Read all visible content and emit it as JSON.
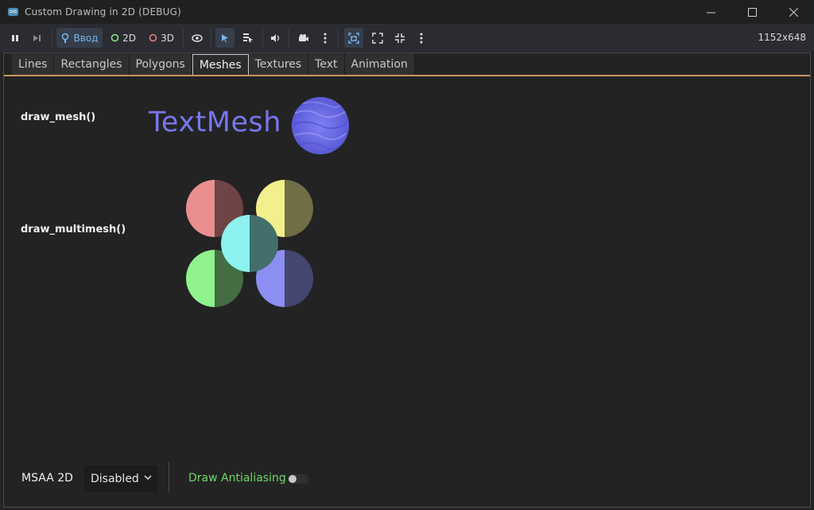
{
  "window": {
    "title": "Custom Drawing in 2D (DEBUG)",
    "resolution": "1152x648"
  },
  "toolbar": {
    "input_label": "Ввод",
    "mode_2d_label": "2D",
    "mode_3d_label": "3D"
  },
  "tabs": [
    {
      "label": "Lines",
      "active": false
    },
    {
      "label": "Rectangles",
      "active": false
    },
    {
      "label": "Polygons",
      "active": false
    },
    {
      "label": "Meshes",
      "active": true
    },
    {
      "label": "Textures",
      "active": false
    },
    {
      "label": "Text",
      "active": false
    },
    {
      "label": "Animation",
      "active": false
    }
  ],
  "meshes": {
    "draw_mesh_label": "draw_mesh()",
    "textmesh_text": "TextMesh",
    "draw_multimesh_label": "draw_multimesh()",
    "multimesh_colors": [
      "#e98f90",
      "#f2f08c",
      "#8ff28c",
      "#8c8ff2",
      "#8ef2ef"
    ]
  },
  "controls": {
    "msaa_label": "MSAA 2D",
    "msaa_value": "Disabled",
    "antialiasing_label": "Draw Antialiasing",
    "antialiasing_on": false
  },
  "colors": {
    "accent_orange": "#c7935c",
    "textmesh": "#7777ee",
    "toggle_label": "#6ed86a"
  }
}
